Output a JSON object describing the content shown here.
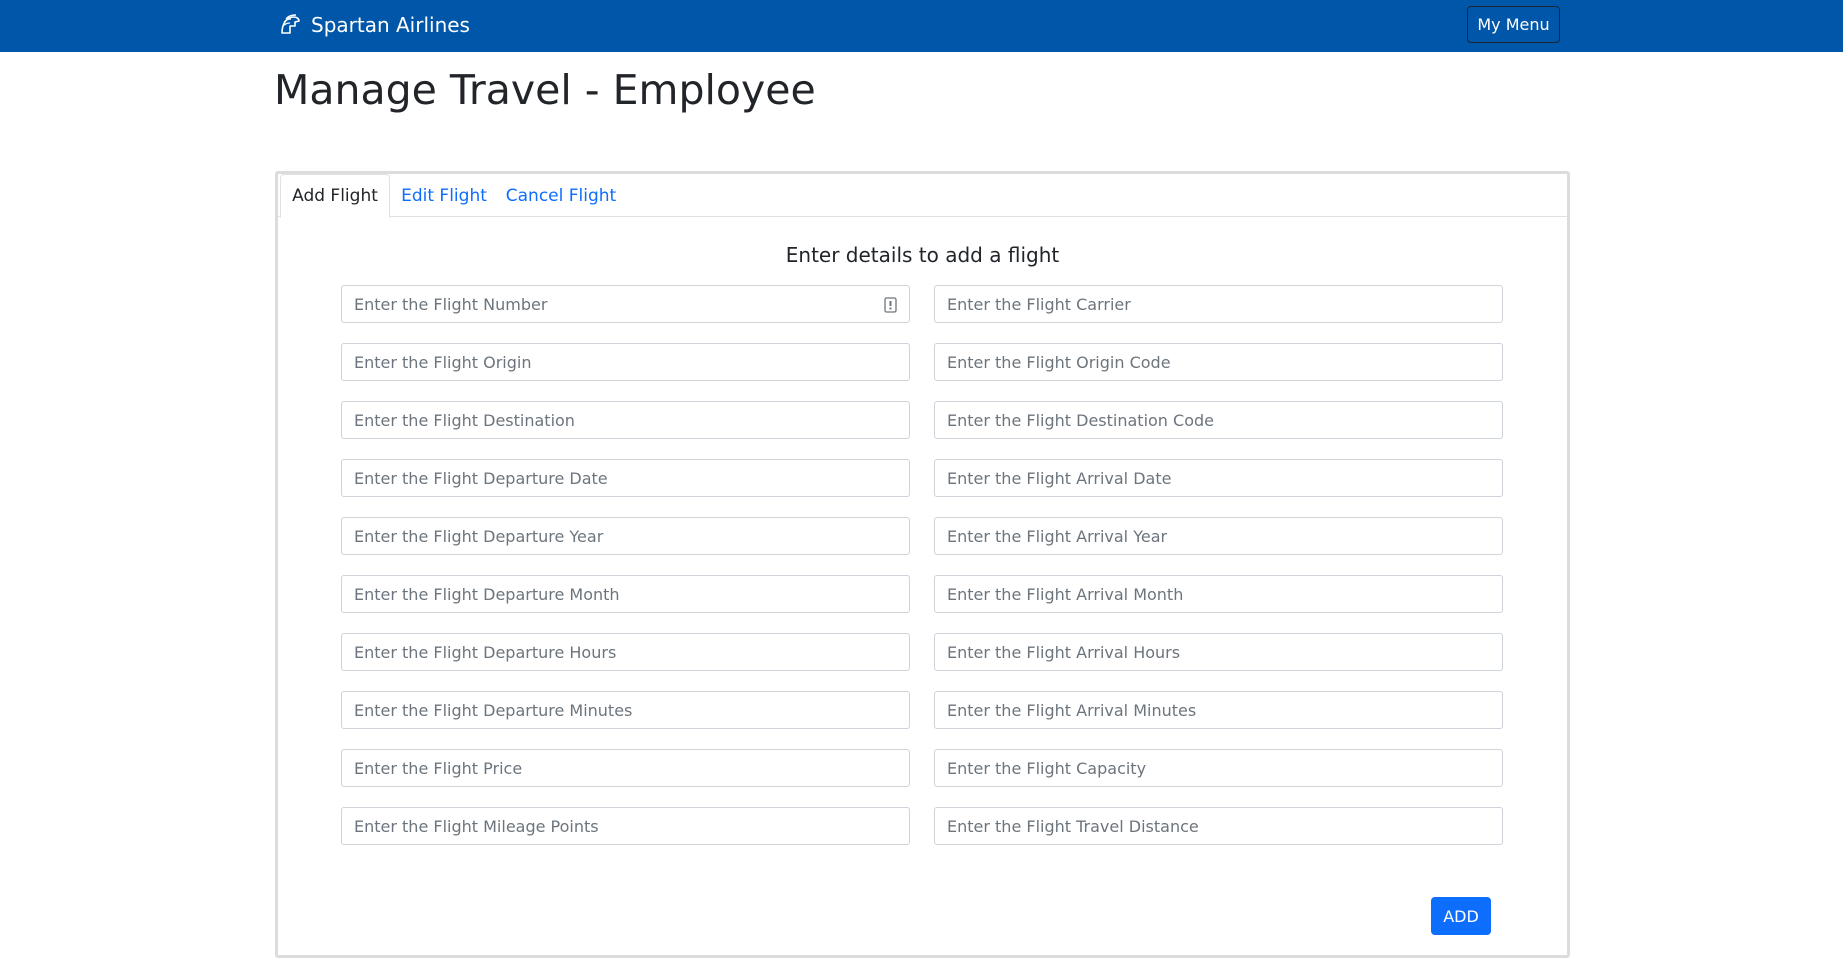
{
  "navbar": {
    "brand": "Spartan Airlines",
    "brand_icon": "spartan-helmet-icon",
    "menu_button": "My Menu"
  },
  "page": {
    "title": "Manage Travel - Employee"
  },
  "tabs": [
    {
      "label": "Add Flight",
      "active": true
    },
    {
      "label": "Edit Flight",
      "active": false
    },
    {
      "label": "Cancel Flight",
      "active": false
    }
  ],
  "form": {
    "heading": "Enter details to add a flight",
    "fields": {
      "flight_number": {
        "placeholder": "Enter the Flight Number",
        "value": ""
      },
      "flight_carrier": {
        "placeholder": "Enter the Flight Carrier",
        "value": ""
      },
      "flight_origin": {
        "placeholder": "Enter the Flight Origin",
        "value": ""
      },
      "flight_origin_code": {
        "placeholder": "Enter the Flight Origin Code",
        "value": ""
      },
      "flight_destination": {
        "placeholder": "Enter the Flight Destination",
        "value": ""
      },
      "flight_destination_code": {
        "placeholder": "Enter the Flight Destination Code",
        "value": ""
      },
      "departure_date": {
        "placeholder": "Enter the Flight Departure Date",
        "value": ""
      },
      "arrival_date": {
        "placeholder": "Enter the Flight Arrival Date",
        "value": ""
      },
      "departure_year": {
        "placeholder": "Enter the Flight Departure Year",
        "value": ""
      },
      "arrival_year": {
        "placeholder": "Enter the Flight Arrival Year",
        "value": ""
      },
      "departure_month": {
        "placeholder": "Enter the Flight Departure Month",
        "value": ""
      },
      "arrival_month": {
        "placeholder": "Enter the Flight Arrival Month",
        "value": ""
      },
      "departure_hours": {
        "placeholder": "Enter the Flight Departure Hours",
        "value": ""
      },
      "arrival_hours": {
        "placeholder": "Enter the Flight Arrival Hours",
        "value": ""
      },
      "departure_minutes": {
        "placeholder": "Enter the Flight Departure Minutes",
        "value": ""
      },
      "arrival_minutes": {
        "placeholder": "Enter the Flight Arrival Minutes",
        "value": ""
      },
      "flight_price": {
        "placeholder": "Enter the Flight Price",
        "value": ""
      },
      "flight_capacity": {
        "placeholder": "Enter the Flight Capacity",
        "value": ""
      },
      "mileage_points": {
        "placeholder": "Enter the Flight Mileage Points",
        "value": ""
      },
      "travel_distance": {
        "placeholder": "Enter the Flight Travel Distance",
        "value": ""
      }
    },
    "submit_button": "ADD"
  },
  "colors": {
    "navbar": "#0056a8",
    "primary": "#0d6efd",
    "link": "#0d6efd"
  }
}
